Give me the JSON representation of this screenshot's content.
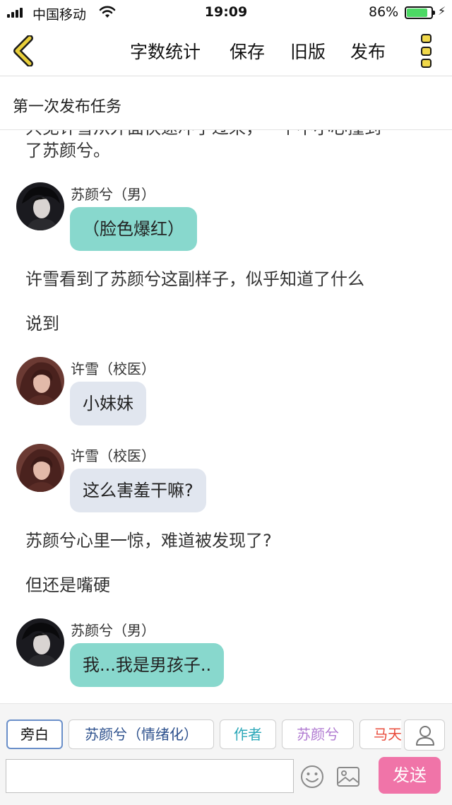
{
  "status_bar": {
    "carrier": "中国移动",
    "time": "19:09",
    "battery": "86%",
    "battery_level": 0.86
  },
  "nav": {
    "word_count": "字数统计",
    "save": "保存",
    "old_version": "旧版",
    "publish": "发布"
  },
  "title": "第一次发布任务",
  "story": {
    "partial_top_line": "只见许雪从外面快速冲了过来，一个不小心撞到",
    "partial_top_line2": "了苏颜兮。",
    "blocks": [
      {
        "speaker": "苏颜兮（男）",
        "text": "（脸色爆红）"
      },
      {
        "narration": "许雪看到了苏颜兮这副样子，似乎知道了什么"
      },
      {
        "narration": "说到"
      },
      {
        "speaker": "许雪（校医）",
        "text": "小妹妹"
      },
      {
        "speaker": "许雪（校医）",
        "text": "这么害羞干嘛?"
      },
      {
        "narration": "苏颜兮心里一惊，难道被发现了?"
      },
      {
        "narration": "但还是嘴硬"
      },
      {
        "speaker": "苏颜兮（男）",
        "text": "我...我是男孩子.."
      }
    ]
  },
  "roles": [
    {
      "label": "旁白",
      "color": "#111111"
    },
    {
      "label": "苏颜兮（情绪化）",
      "color": "#2b4f8c"
    },
    {
      "label": "作者",
      "color": "#2aa7b8"
    },
    {
      "label": "苏颜兮",
      "color": "#b07ad1"
    },
    {
      "label": "马天",
      "color": "#e84a3a"
    }
  ],
  "input": {
    "value": "",
    "placeholder": ""
  },
  "send_label": "发送",
  "colors": {
    "bubble_male": "#88d8cd",
    "bubble_doctor": "#e1e6ef",
    "send_button": "#f074a8",
    "back_arrow": "#e9cf3b"
  }
}
